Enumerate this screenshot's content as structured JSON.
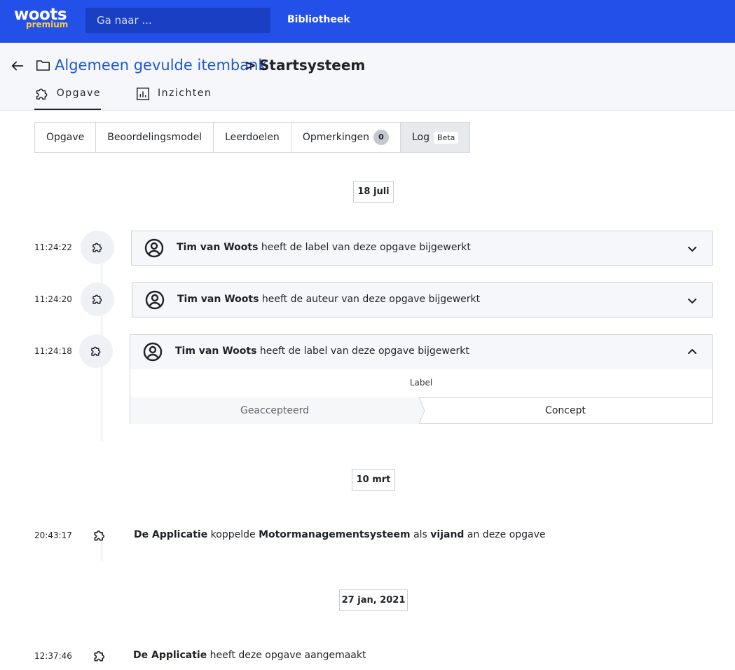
{
  "topbar": {
    "logo_main": "woots",
    "logo_sub": "premium",
    "search_placeholder": "Ga naar ...",
    "nav_library": "Bibliotheek",
    "color": "#2350e8"
  },
  "breadcrumb": {
    "link": "Algemeen gevulde itembank",
    "separator": ">",
    "current": "Startsysteem"
  },
  "tabs": [
    {
      "label": "Opgave",
      "icon": "puzzle-icon",
      "active": true
    },
    {
      "label": "Inzichten",
      "icon": "chart-icon",
      "active": false
    }
  ],
  "subtabs": {
    "opgave": "Opgave",
    "beoordelingsmodel": "Beoordelingsmodel",
    "leerdoelen": "Leerdoelen",
    "opmerkingen": "Opmerkingen",
    "opmerkingen_count": "0",
    "log": "Log",
    "log_badge": "Beta"
  },
  "log": {
    "groups": [
      {
        "date": "18 juli",
        "entries": [
          {
            "time": "11:24:22",
            "actor": "Tim van Woots",
            "action": "heeft de label van deze opgave bijgewerkt",
            "expanded": false
          },
          {
            "time": "11:24:20",
            "actor": "Tim van Woots",
            "action": "heeft de auteur van deze opgave bijgewerkt",
            "expanded": false
          },
          {
            "time": "11:24:18",
            "actor": "Tim van Woots",
            "action": "heeft de label van deze opgave bijgewerkt",
            "expanded": true,
            "diff": {
              "field": "Label",
              "old": "Geaccepteerd",
              "new": "Concept"
            }
          }
        ]
      },
      {
        "date": "10 mrt",
        "entries": [
          {
            "time": "20:43:17",
            "actor": "De Applicatie",
            "w1": "koppelde",
            "object": "Motormanagementsysteem",
            "w2": "als",
            "role": "vijand",
            "w3": "an deze opgave"
          }
        ]
      },
      {
        "date": "27 jan, 2021",
        "entries": [
          {
            "time": "12:37:46",
            "actor": "De Applicatie",
            "action": "heeft deze opgave aangemaakt"
          }
        ]
      }
    ]
  }
}
